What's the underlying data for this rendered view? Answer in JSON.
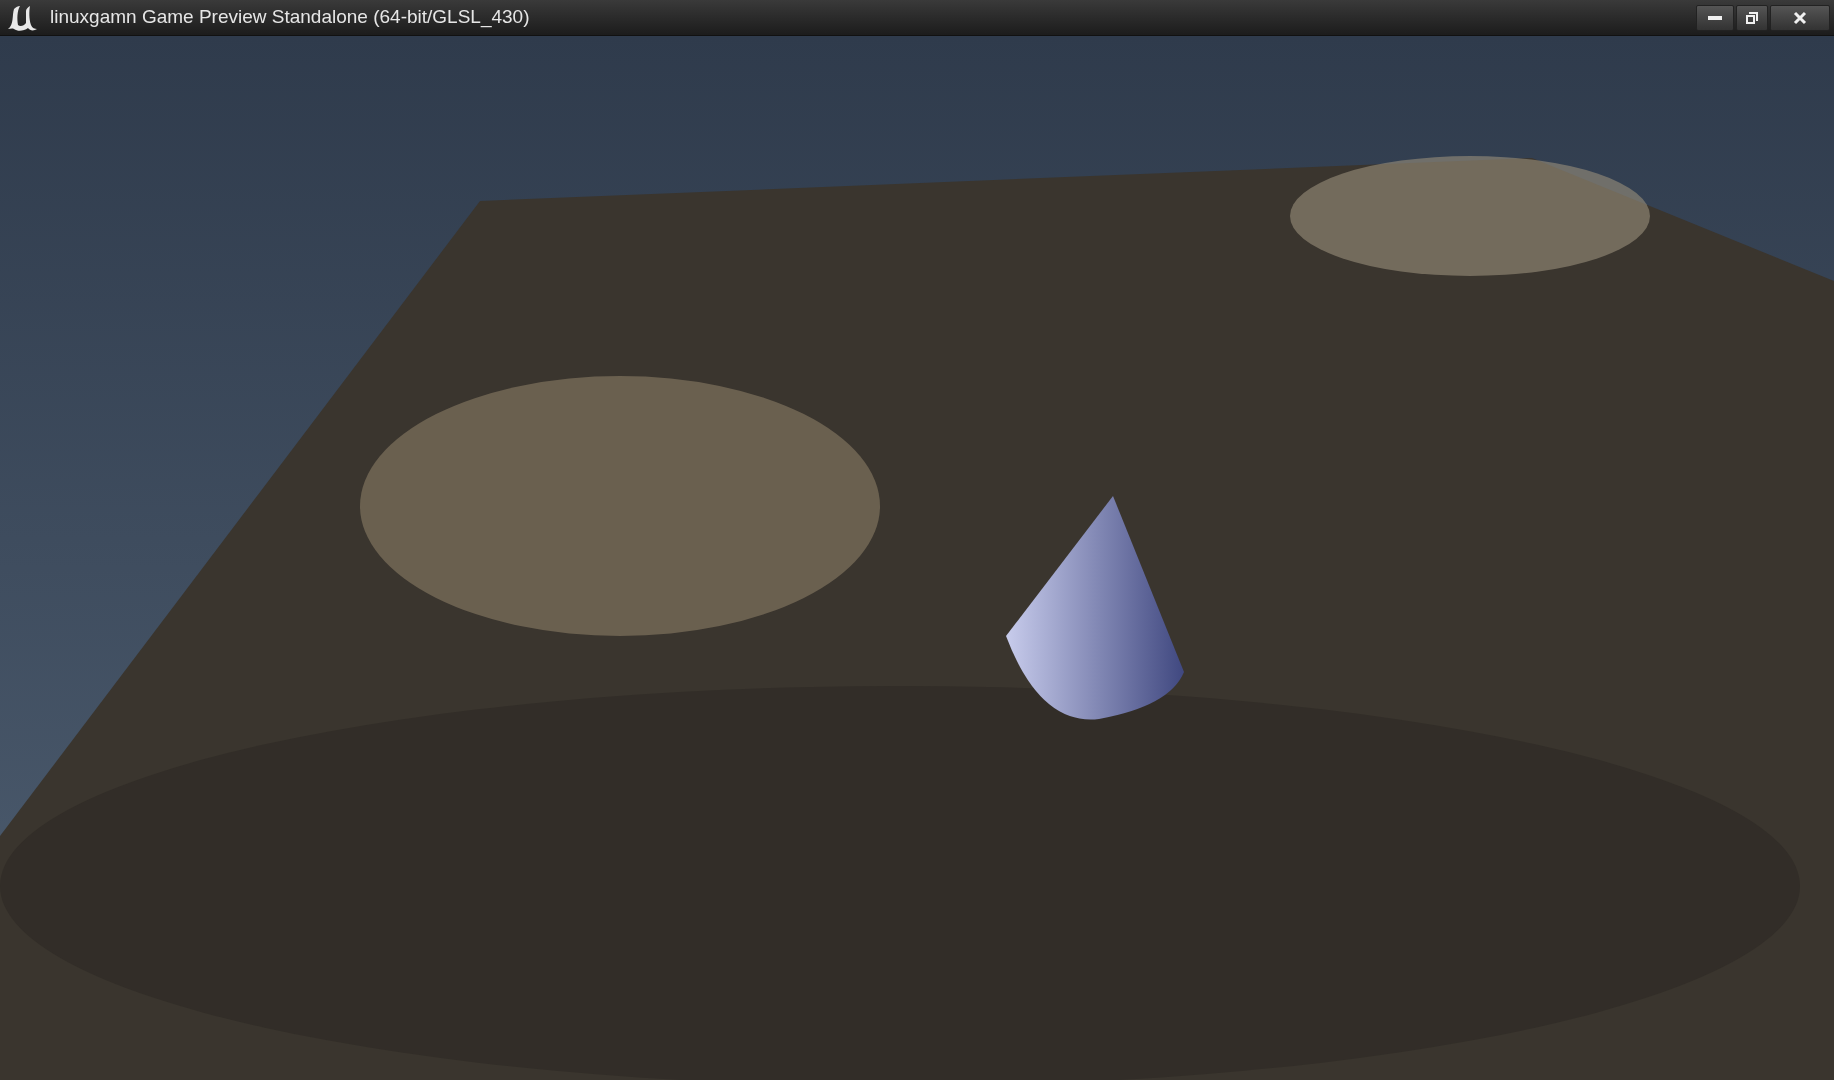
{
  "window": {
    "title": "linuxgamn Game Preview Standalone (64-bit/GLSL_430)"
  }
}
